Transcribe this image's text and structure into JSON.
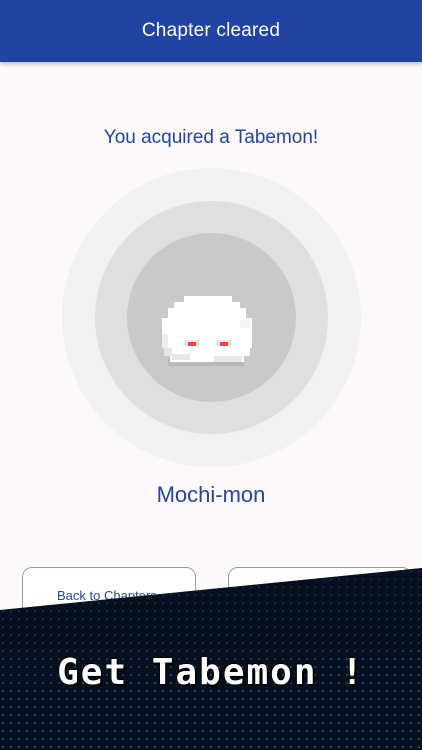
{
  "header": {
    "title": "Chapter cleared"
  },
  "reward": {
    "headline": "You acquired a Tabemon!",
    "monster_name": "Mochi-mon",
    "monster_sprite": "mochi-blob-pixel-sprite"
  },
  "actions": {
    "back_label": "Back to Chapters",
    "second_label": ""
  },
  "banner": {
    "text": "Get Tabemon !"
  },
  "colors": {
    "header_bg": "#2143a3",
    "accent_text": "#22479a",
    "banner_bg": "#06101f",
    "banner_dots": "#2bb3d6"
  }
}
